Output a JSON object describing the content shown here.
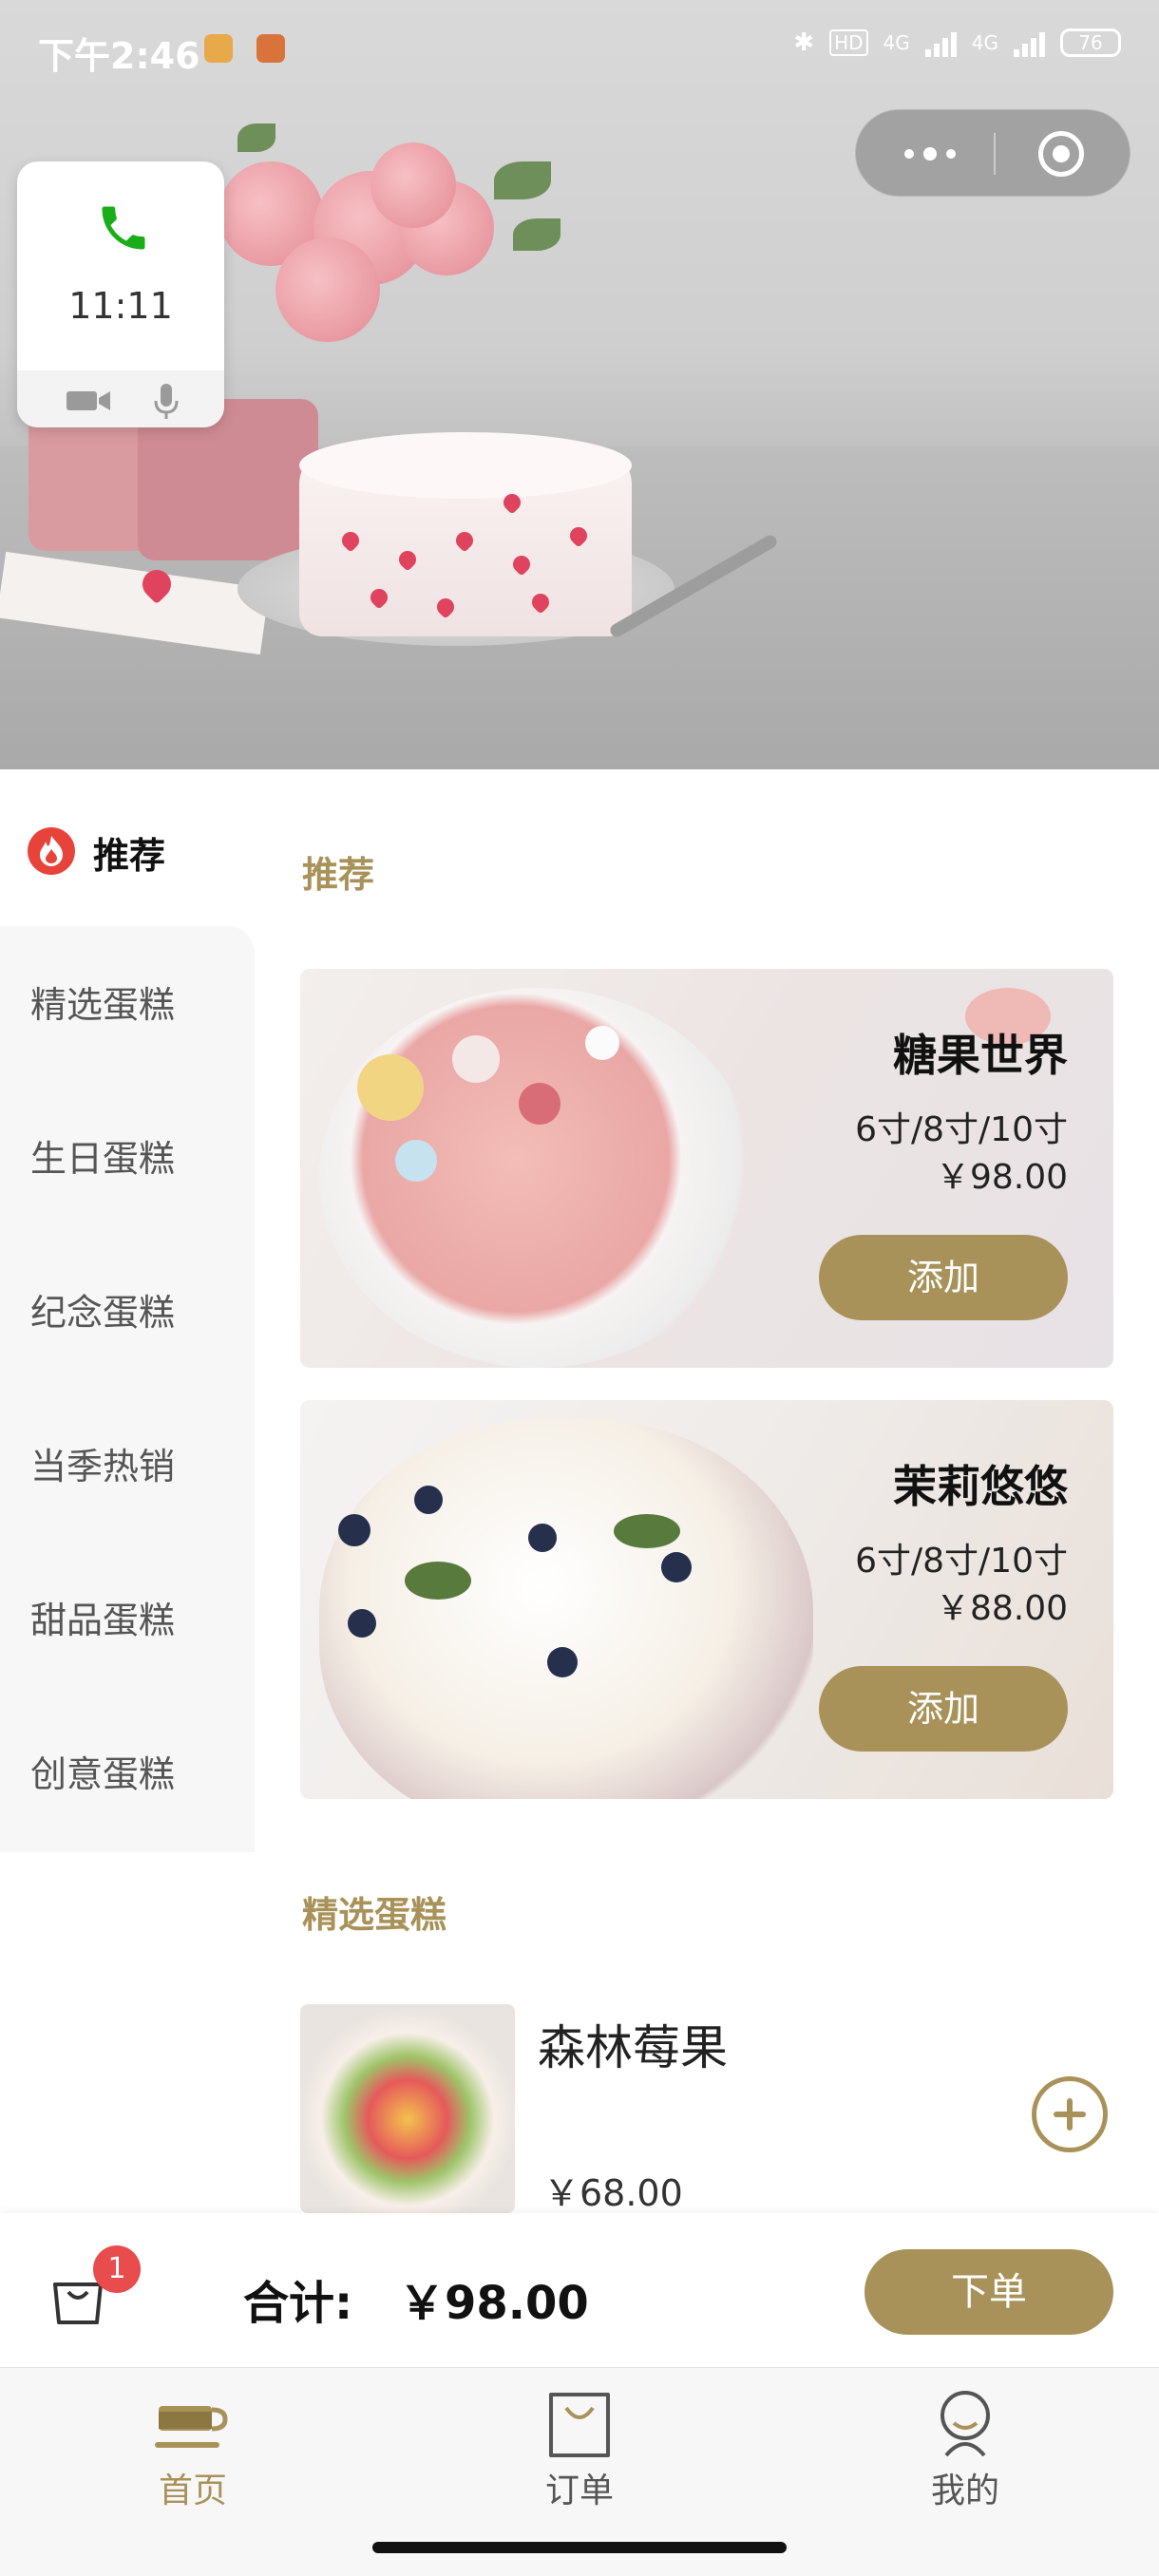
{
  "status_bar": {
    "time": "下午2:46",
    "network_1": "4G",
    "network_2": "4G",
    "battery": "76"
  },
  "call_widget": {
    "duration": "11:11",
    "icon": "phone-icon"
  },
  "sidebar": {
    "active": {
      "label": "推荐",
      "icon": "fire-icon"
    },
    "items": [
      {
        "label": "精选蛋糕"
      },
      {
        "label": "生日蛋糕"
      },
      {
        "label": "纪念蛋糕"
      },
      {
        "label": "当季热销"
      },
      {
        "label": "甜品蛋糕"
      },
      {
        "label": "创意蛋糕"
      }
    ]
  },
  "main": {
    "section_recommend": "推荐",
    "promos": [
      {
        "name": "糖果世界",
        "sizes": "6寸/8寸/10寸",
        "price": "￥98.00",
        "button": "添加"
      },
      {
        "name": "茉莉悠悠",
        "sizes": "6寸/8寸/10寸",
        "price": "￥88.00",
        "button": "添加"
      }
    ],
    "section_selected": "精选蛋糕",
    "products": [
      {
        "name": "森林莓果",
        "price": "￥68.00",
        "add_icon": "plus-circle-icon"
      }
    ]
  },
  "cart": {
    "badge_count": "1",
    "total_label": "合计:",
    "total_value": "￥98.00",
    "order_button": "下单"
  },
  "tabbar": {
    "tabs": [
      {
        "label": "首页",
        "icon": "coffee-cup-icon",
        "active": true
      },
      {
        "label": "订单",
        "icon": "shopping-bag-icon",
        "active": false
      },
      {
        "label": "我的",
        "icon": "user-icon",
        "active": false
      }
    ]
  },
  "colors": {
    "accent": "#a89259",
    "badge": "#e84c4c",
    "call_green": "#1aad19"
  }
}
